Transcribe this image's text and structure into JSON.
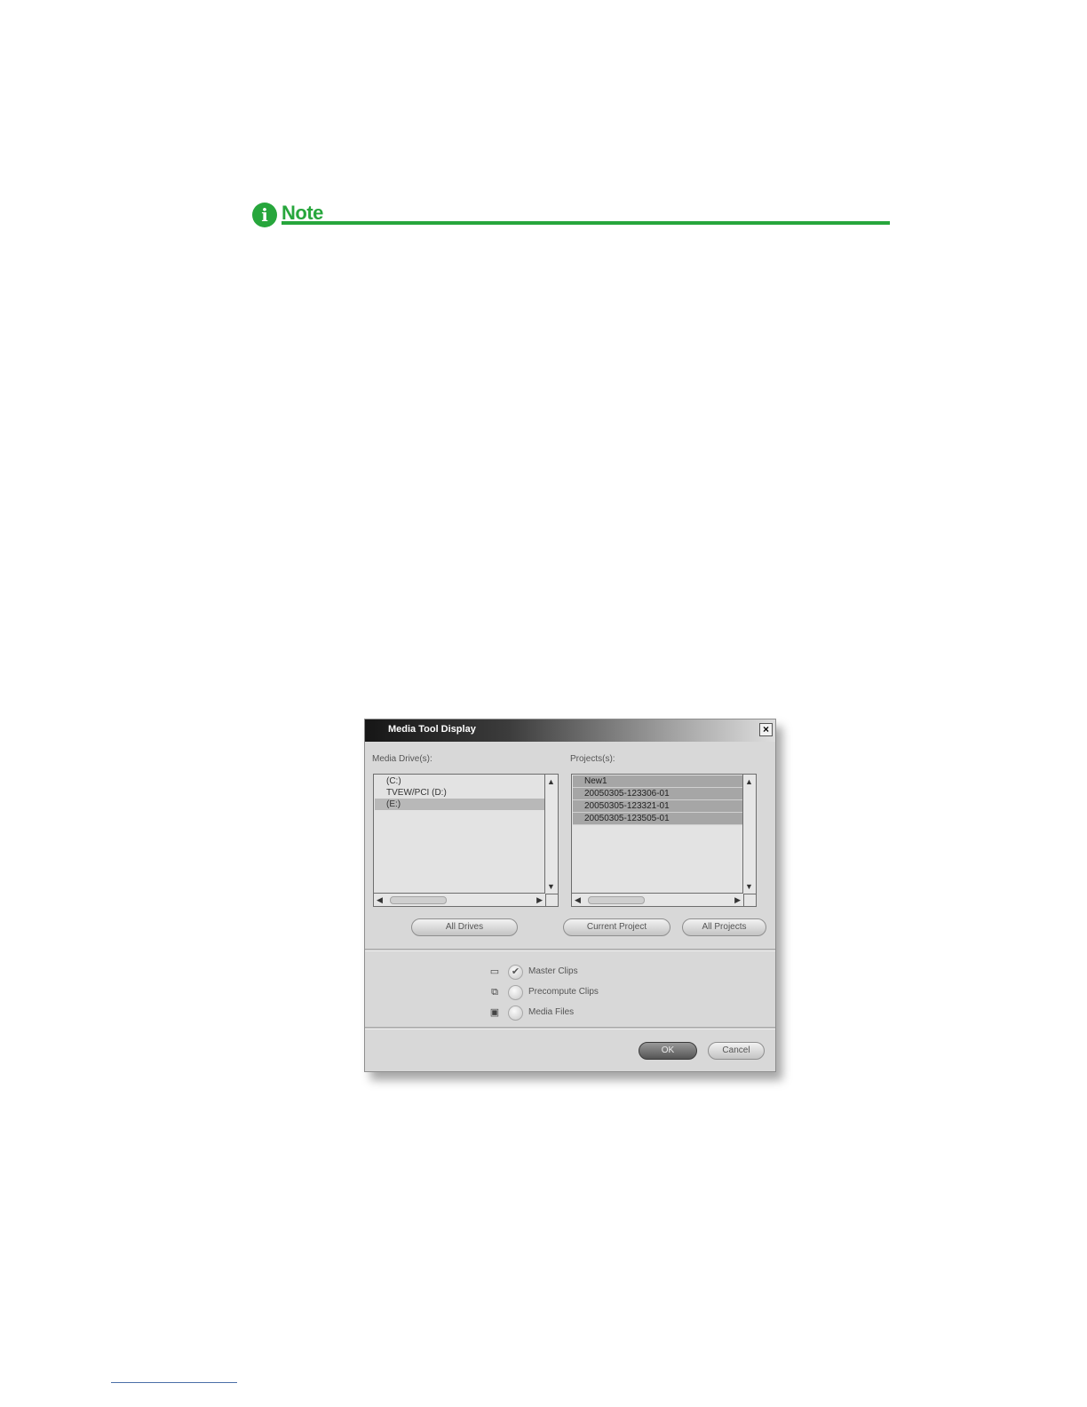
{
  "note": {
    "icon": "info-icon",
    "icon_glyph": "i",
    "label": "Note",
    "color": "#27a63c"
  },
  "dialog": {
    "title": "Media Tool Display",
    "close_glyph": "×",
    "media_drives": {
      "label": "Media Drive(s):",
      "items": [
        "(C:)",
        "TVEW/PCI (D:)",
        "(E:)"
      ],
      "selected_index": 2
    },
    "projects": {
      "label": "Projects(s):",
      "items": [
        "New1",
        "20050305-123306-01",
        "20050305-123321-01",
        "20050305-123505-01"
      ]
    },
    "buttons": {
      "all_drives": "All Drives",
      "current_project": "Current Project",
      "all_projects": "All Projects",
      "ok": "OK",
      "cancel": "Cancel"
    },
    "options": [
      {
        "icon": "clip-icon",
        "glyph": "▭",
        "label": "Master Clips",
        "checked": true
      },
      {
        "icon": "precompute-icon",
        "glyph": "⧉",
        "label": "Precompute Clips",
        "checked": false
      },
      {
        "icon": "media-file-icon",
        "glyph": "▣",
        "label": "Media Files",
        "checked": false
      }
    ]
  }
}
